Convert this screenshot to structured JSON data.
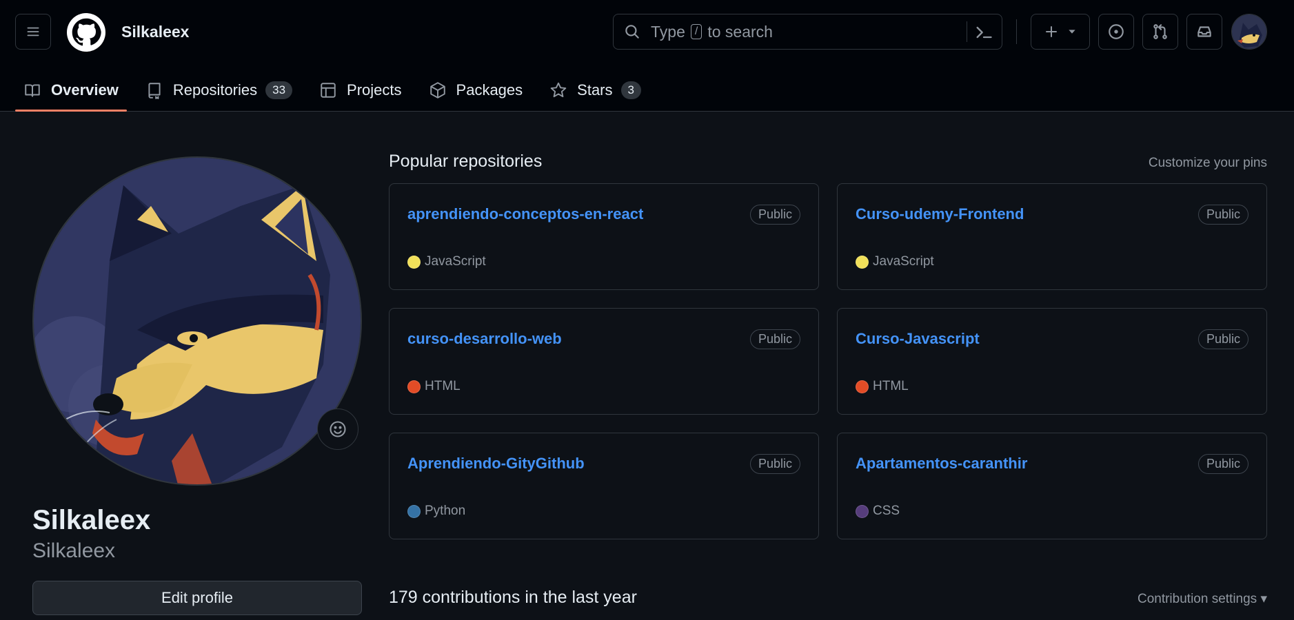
{
  "header": {
    "username": "Silkaleex",
    "search": {
      "prefix": "Type",
      "key": "/",
      "suffix": "to search"
    }
  },
  "tabs": [
    {
      "label": "Overview",
      "icon": "book-icon",
      "active": true
    },
    {
      "label": "Repositories",
      "icon": "repo-icon",
      "count": "33"
    },
    {
      "label": "Projects",
      "icon": "table-icon"
    },
    {
      "label": "Packages",
      "icon": "package-icon"
    },
    {
      "label": "Stars",
      "icon": "star-icon",
      "count": "3"
    }
  ],
  "profile": {
    "name": "Silkaleex",
    "login": "Silkaleex",
    "edit_label": "Edit profile"
  },
  "popular": {
    "title": "Popular repositories",
    "customize_label": "Customize your pins",
    "repos": [
      {
        "name": "aprendiendo-conceptos-en-react",
        "visibility": "Public",
        "language": "JavaScript",
        "color": "#f1e05a"
      },
      {
        "name": "Curso-udemy-Frontend",
        "visibility": "Public",
        "language": "JavaScript",
        "color": "#f1e05a"
      },
      {
        "name": "curso-desarrollo-web",
        "visibility": "Public",
        "language": "HTML",
        "color": "#e34c26"
      },
      {
        "name": "Curso-Javascript",
        "visibility": "Public",
        "language": "HTML",
        "color": "#e34c26"
      },
      {
        "name": "Aprendiendo-GityGithub",
        "visibility": "Public",
        "language": "Python",
        "color": "#3572A5"
      },
      {
        "name": "Apartamentos-caranthir",
        "visibility": "Public",
        "language": "CSS",
        "color": "#563d7c"
      }
    ]
  },
  "contributions": {
    "title": "179 contributions in the last year",
    "settings_label": "Contribution settings ▾"
  },
  "colors": {
    "accent_link": "#4493f8",
    "tab_underline": "#f78166",
    "background": "#0d1117",
    "header_bg": "#010409"
  }
}
